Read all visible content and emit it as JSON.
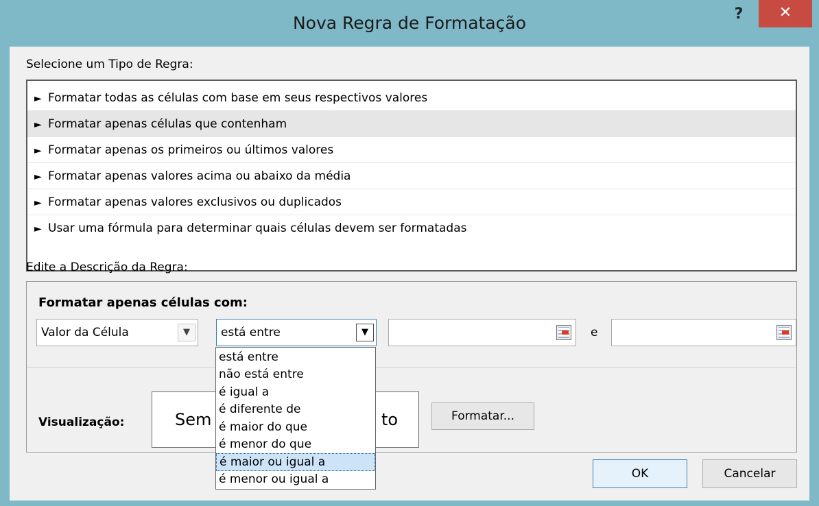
{
  "window": {
    "title": "Nova Regra de Formatação",
    "help": "?",
    "close": "✕"
  },
  "rule_type": {
    "label": "Selecione um Tipo de Regra:",
    "items": [
      "Formatar todas as células com base em seus respectivos valores",
      "Formatar apenas células que contenham",
      "Formatar apenas os primeiros ou últimos valores",
      "Formatar apenas valores acima ou abaixo da média",
      "Formatar apenas valores exclusivos ou duplicados",
      "Usar uma fórmula para determinar quais células devem ser formatadas"
    ],
    "selected_index": 1
  },
  "description": {
    "label": "Edite a Descrição da Regra:",
    "heading": "Formatar apenas células com:",
    "field_combo": "Valor da Célula",
    "operator_combo": "está entre",
    "and_label": "e",
    "operator_options": [
      "está entre",
      "não está entre",
      "é igual a",
      "é diferente de",
      "é maior do que",
      "é menor do que",
      "é maior ou igual a",
      "é menor ou igual a"
    ],
    "highlighted_index": 6
  },
  "preview": {
    "label": "Visualização:",
    "text_left": "Sem",
    "text_right": "to",
    "format_button": "Formatar..."
  },
  "buttons": {
    "ok": "OK",
    "cancel": "Cancelar"
  },
  "icons": {
    "arrow": "►",
    "combo_arrow": "✓"
  }
}
